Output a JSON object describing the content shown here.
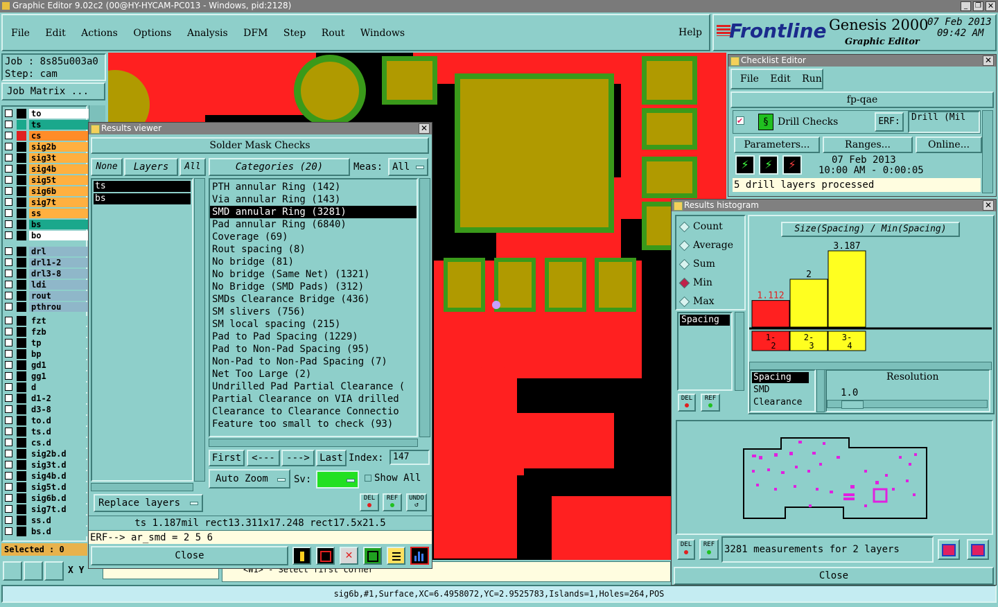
{
  "os_title": "Graphic Editor 9.02c2 (00@HY-HYCAM-PC013 - Windows, pid:2128)",
  "menu": [
    "File",
    "Edit",
    "Actions",
    "Options",
    "Analysis",
    "DFM",
    "Step",
    "Rout",
    "Windows"
  ],
  "help_label": "Help",
  "brand": {
    "logo": "Frontline",
    "product": "Genesis 2000",
    "subtitle": "Graphic Editor",
    "date": "07 Feb 2013",
    "time": "09:42 AM"
  },
  "job": {
    "job_line": "Job : 8s85u003a0",
    "step_line": "Step: cam",
    "matrix_btn": "Job Matrix ..."
  },
  "layers_a": [
    {
      "name": "to",
      "color": "#ffffff",
      "sw": "#000000"
    },
    {
      "name": "ts",
      "color": "#1aa88c",
      "sw": "#1aa88c"
    },
    {
      "name": "cs",
      "color": "#ff8c28",
      "sw": "#e02020"
    },
    {
      "name": "sig2b",
      "color": "#ffb040",
      "sw": "#000000"
    },
    {
      "name": "sig3t",
      "color": "#ffb040",
      "sw": "#000000"
    },
    {
      "name": "sig4b",
      "color": "#ffb040",
      "sw": "#000000"
    },
    {
      "name": "sig5t",
      "color": "#ffb040",
      "sw": "#000000"
    },
    {
      "name": "sig6b",
      "color": "#ffb040",
      "sw": "#000000"
    },
    {
      "name": "sig7t",
      "color": "#ffb040",
      "sw": "#000000"
    },
    {
      "name": "ss",
      "color": "#ffb040",
      "sw": "#000000"
    },
    {
      "name": "bs",
      "color": "#1aa88c",
      "sw": "#000000"
    },
    {
      "name": "bo",
      "color": "#ffffff",
      "sw": "#000000"
    }
  ],
  "layers_b": [
    "drl",
    "drl1-2",
    "drl3-8",
    "ldi",
    "rout",
    "pthrou"
  ],
  "layers_c": [
    "fzt",
    "fzb",
    "tp",
    "bp",
    "gd1",
    "gg1",
    "d",
    "d1-2",
    "d3-8",
    "to.d",
    "ts.d",
    "cs.d",
    "sig2b.d",
    "sig3t.d",
    "sig4b.d",
    "sig5t.d",
    "sig6b.d",
    "sig7t.d",
    "ss.d",
    "bs.d"
  ],
  "selected": "Selected : 0",
  "results": {
    "title": "Results viewer",
    "header": "Solder Mask Checks",
    "none_btn": "None",
    "layers_btn": "Layers",
    "all_btn": "All",
    "layers": [
      "ts",
      "bs"
    ],
    "categories_btn": "Categories (20)",
    "meas_label": "Meas:",
    "meas_value": "All",
    "categories": [
      "PTH annular Ring (142)",
      "Via annular Ring (143)",
      "SMD annular Ring (3281)",
      "Pad annular Ring (6840)",
      "Coverage (69)",
      "Rout spacing (8)",
      "No bridge (81)",
      "No bridge (Same Net) (1321)",
      "No Bridge (SMD Pads) (312)",
      "SMDs Clearance Bridge (436)",
      "SM slivers (756)",
      "SM local spacing (215)",
      "Pad to Pad Spacing (1229)",
      "Pad to Non-Pad Spacing (95)",
      "Non-Pad to Non-Pad Spacing (7)",
      "Net Too Large (2)",
      "Undrilled Pad Partial Clearance (",
      "Partial Clearance on VIA drilled",
      "Clearance to Clearance Connectio",
      "Feature too small to check (93)"
    ],
    "first": "First",
    "prev": "<---",
    "next": "--->",
    "last": "Last",
    "index_label": "Index:",
    "index_value": "147",
    "auto_zoom": "Auto Zoom",
    "sv_label": "Sv:",
    "show_all": "Show All",
    "replace_layers": "Replace layers",
    "del": "DEL",
    "ref": "REF",
    "undo": "UNDO",
    "info": "ts 1.187mil   rect13.311x17.248   rect17.5x21.5",
    "erf": "ERF--> ar_smd = 2 5 6",
    "close": "Close"
  },
  "checklist": {
    "title": "Checklist Editor",
    "menu": [
      "File",
      "Edit",
      "Run"
    ],
    "name": "fp-qae",
    "check_name": "Drill Checks",
    "erf_label": "ERF:",
    "erf_value": "Drill (Mil",
    "params": "Parameters...",
    "ranges": "Ranges...",
    "online": "Online...",
    "date": "07 Feb 2013",
    "time": "10:00 AM - 0:00:05",
    "status": "5 drill layers processed"
  },
  "histogram": {
    "title": "Results histogram",
    "modes": [
      "Count",
      "Average",
      "Sum",
      "Min",
      "Max"
    ],
    "selected_mode": "Min",
    "chart_title": "Size(Spacing) / Min(Spacing)",
    "left_list": [
      "Spacing"
    ],
    "attr_list": [
      "Spacing",
      "SMD",
      "Clearance"
    ],
    "resolution_label": "Resolution",
    "resolution_value": "1.0",
    "summary": "3281 measurements for 2 layers",
    "close": "Close"
  },
  "chart_data": {
    "type": "bar",
    "title": "Size(Spacing) / Min(Spacing)",
    "categories": [
      "1-2",
      "2-3",
      "3-4"
    ],
    "values": [
      1.112,
      2,
      3.187
    ],
    "value_labels": [
      "1.112",
      "2",
      "3.187"
    ],
    "colors": [
      "#ff2020",
      "#ffff20",
      "#ffff20"
    ]
  },
  "coords": {
    "xy_label": "X Y",
    "prompt": "<W1> - Select first corner"
  },
  "statusbar": "sig6b,#1,Surface,XC=6.4958072,YC=2.9525783,Islands=1,Holes=264,POS"
}
